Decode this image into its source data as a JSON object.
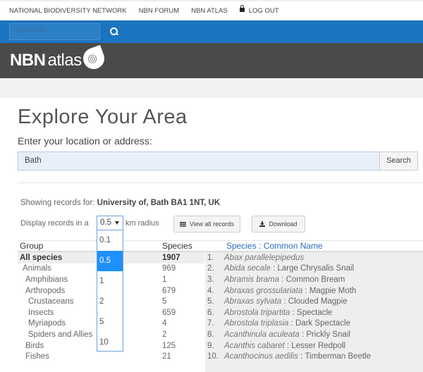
{
  "topnav": {
    "items": [
      "NATIONAL BIODIVERSITY NETWORK",
      "NBN FORUM",
      "NBN ATLAS"
    ],
    "logout": "LOG OUT"
  },
  "search": {
    "placeholder": "SEARCH"
  },
  "logo": {
    "nbn": "NBN",
    "atlas": "atlas"
  },
  "page": {
    "title": "Explore Your Area",
    "location_label": "Enter your location or address:",
    "location_value": "Bath",
    "search_button": "Search"
  },
  "showing": {
    "prefix": "Showing records for:",
    "place": "University of, Bath BA1 1NT, UK"
  },
  "radius": {
    "prefix": "Display records in a",
    "value": "0.5",
    "suffix": "km radius",
    "options": [
      "0.1",
      "0.5",
      "1",
      "2",
      "5",
      "10"
    ]
  },
  "buttons": {
    "view_all": "View all records",
    "download": "Download"
  },
  "groups": {
    "header_group": "Group",
    "header_species": "Species",
    "rows": [
      {
        "name": "All species",
        "count": "1907",
        "level": 0
      },
      {
        "name": "Animals",
        "count": "969",
        "level": 1
      },
      {
        "name": "Amphibians",
        "count": "1",
        "level": 2
      },
      {
        "name": "Arthropods",
        "count": "679",
        "level": 2
      },
      {
        "name": "Crustaceans",
        "count": "5",
        "level": 3
      },
      {
        "name": "Insects",
        "count": "659",
        "level": 3
      },
      {
        "name": "Myriapods",
        "count": "4",
        "level": 3
      },
      {
        "name": "Spiders and Allies",
        "count": "2",
        "level": 3
      },
      {
        "name": "Birds",
        "count": "125",
        "level": 2
      },
      {
        "name": "Fishes",
        "count": "21",
        "level": 2
      }
    ]
  },
  "species": {
    "header": "Species : Common Name",
    "rows": [
      {
        "i": "1.",
        "sci": "Abax parallelepipedus",
        "common": ""
      },
      {
        "i": "2.",
        "sci": "Abida secale",
        "common": "Large Chrysalis Snail"
      },
      {
        "i": "3.",
        "sci": "Abramis brama",
        "common": "Common Bream"
      },
      {
        "i": "4.",
        "sci": "Abraxas grossulariata",
        "common": "Magpie Moth"
      },
      {
        "i": "5.",
        "sci": "Abraxas sylvata",
        "common": "Clouded Magpie"
      },
      {
        "i": "6.",
        "sci": "Abrostola tripartita",
        "common": "Spectacle"
      },
      {
        "i": "7.",
        "sci": "Abrostola triplasia",
        "common": "Dark Spectacle"
      },
      {
        "i": "8.",
        "sci": "Acanthinula aculeata",
        "common": "Prickly Snail"
      },
      {
        "i": "9.",
        "sci": "Acanthis cabaret",
        "common": "Lesser Redpoll"
      },
      {
        "i": "10.",
        "sci": "Acanthocinus aedilis",
        "common": "Timberman Beetle"
      }
    ]
  }
}
